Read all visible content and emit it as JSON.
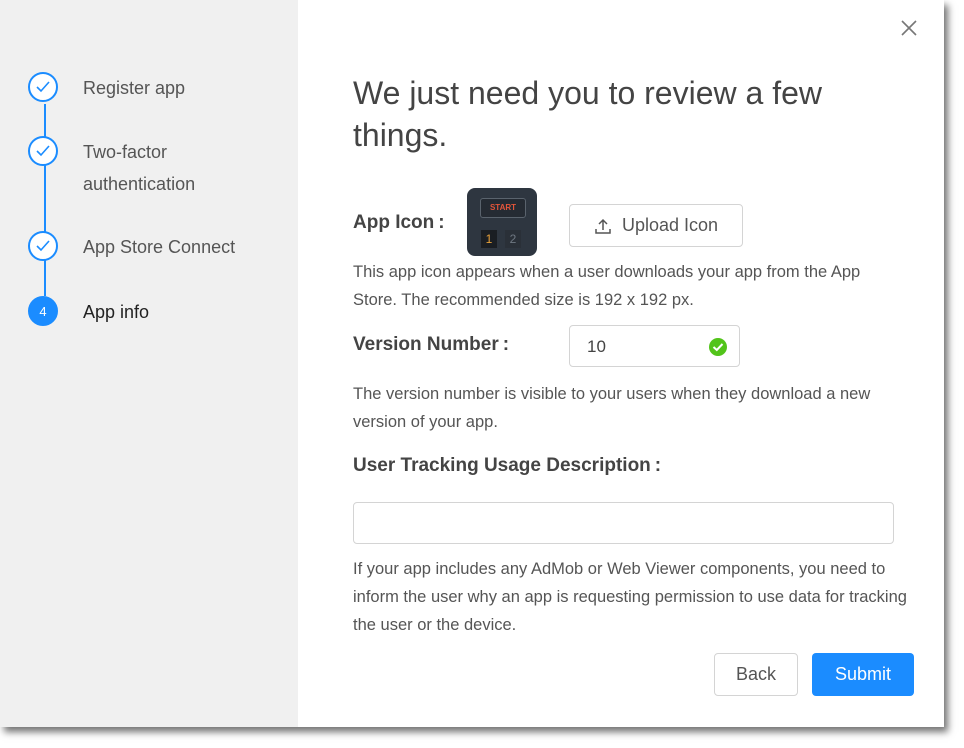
{
  "steps": [
    {
      "label": "Register app",
      "status": "done"
    },
    {
      "label": "Two-factor authentication",
      "status": "done"
    },
    {
      "label": "App Store Connect",
      "status": "done"
    },
    {
      "label": "App info",
      "number": "4",
      "status": "current"
    }
  ],
  "dialog": {
    "title": "We just need you to review a few things.",
    "close_icon": "close-icon"
  },
  "app_icon": {
    "label": "App Icon",
    "separator": ":",
    "image_start_text": "START",
    "image_num1": "1",
    "image_num2": "2",
    "upload_label": "Upload Icon",
    "upload_icon": "upload-icon",
    "description": "This app icon appears when a user downloads your app from the App Store. The recommended size is 192 x 192 px."
  },
  "version": {
    "label": "Version Number",
    "separator": ":",
    "value": "10",
    "valid_icon": "check-circle-icon",
    "description": "The version number is visible to your users when they download a new version of your app."
  },
  "tracking": {
    "label": "User Tracking Usage Description",
    "separator": ":",
    "value": "",
    "placeholder": "",
    "description": "If your app includes any AdMob or Web Viewer components, you need to inform the user why an app is requesting permission to use data for tracking the user or the device."
  },
  "actions": {
    "back_label": "Back",
    "submit_label": "Submit"
  },
  "colors": {
    "accent": "#1b8cff",
    "success": "#52c41a",
    "sidebar_bg": "#f0f0f0"
  }
}
